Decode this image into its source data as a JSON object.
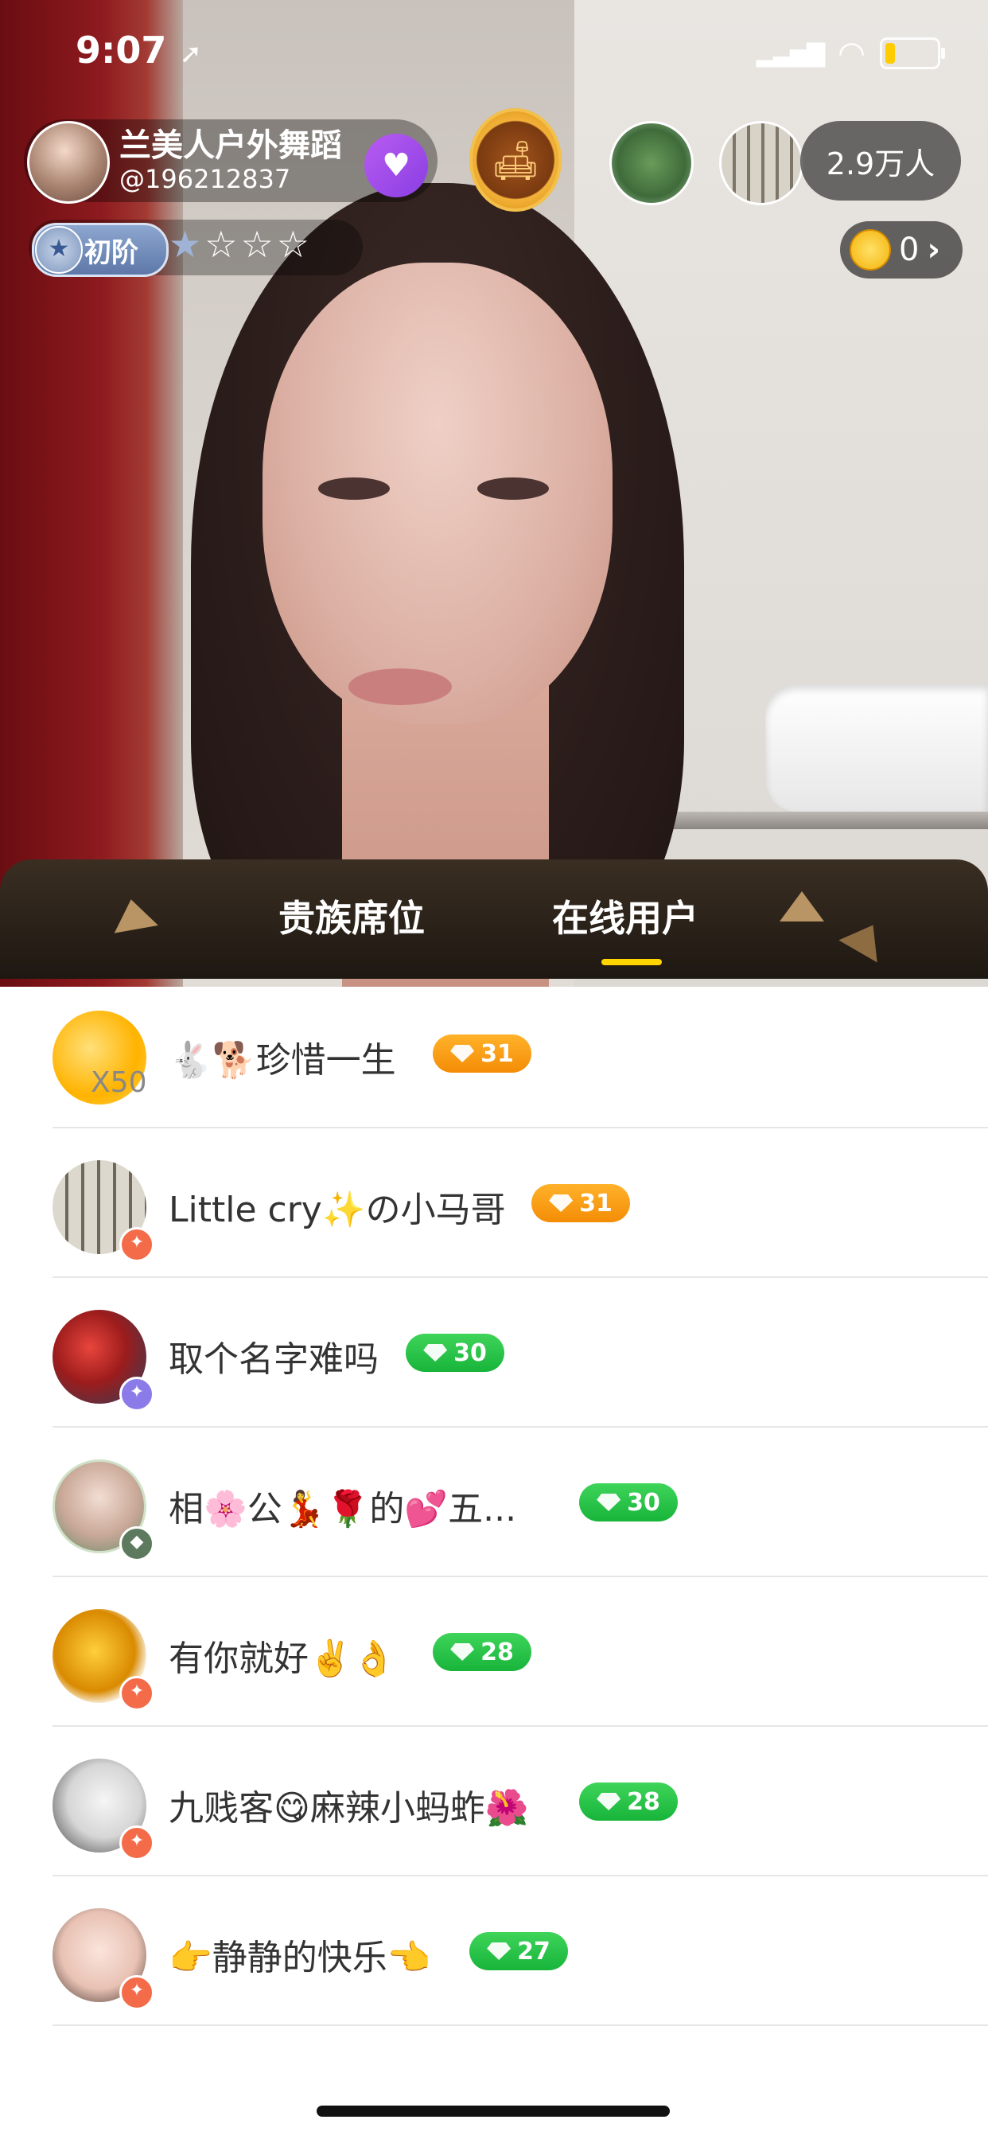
{
  "status_bar": {
    "time": "9:07"
  },
  "host": {
    "name": "兰美人户外舞蹈",
    "id": "@196212837"
  },
  "viewers": {
    "count_label": "2.9万人"
  },
  "level": {
    "label": "初阶",
    "stars_filled": 1,
    "stars_total": 4
  },
  "coins": {
    "value": "0"
  },
  "tabs": [
    {
      "label": "贵族席位",
      "active": false
    },
    {
      "label": "在线用户",
      "active": true
    }
  ],
  "users": [
    {
      "name": "🐇🐕珍惜一生",
      "level": "31",
      "tag_color": "orange",
      "avatar_overlay": "X50"
    },
    {
      "name": "Little cry✨の小马哥",
      "level": "31",
      "tag_color": "orange"
    },
    {
      "name": "取个名字难吗",
      "level": "30",
      "tag_color": "green"
    },
    {
      "name": "相🌸公💃🌹的💕五...",
      "level": "30",
      "tag_color": "green"
    },
    {
      "name": "有你就好✌️👌",
      "level": "28",
      "tag_color": "green"
    },
    {
      "name": "九贱客😋麻辣小蚂蚱🌺",
      "level": "28",
      "tag_color": "green"
    },
    {
      "name": "👉静静的快乐👈",
      "level": "27",
      "tag_color": "green"
    }
  ]
}
